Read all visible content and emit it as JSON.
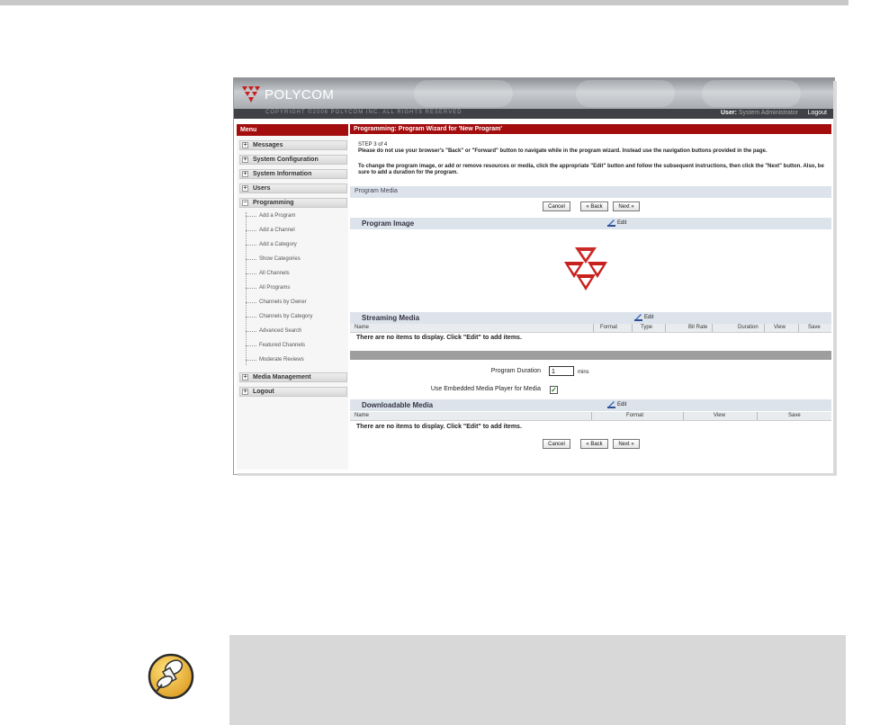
{
  "header": {
    "brand": "POLYCOM",
    "copyright": "COPYRIGHT ©2006 POLYCOM INC. ALL RIGHTS RESERVED",
    "user_label": "User:",
    "user_name": "System Administrator",
    "logout": "Logout"
  },
  "menu": {
    "title": "Menu",
    "cats": {
      "messages": "Messages",
      "system_configuration": "System Configuration",
      "system_information": "System Information",
      "users": "Users",
      "programming": "Programming",
      "media_management": "Media Management",
      "logout": "Logout"
    },
    "programming_items": [
      "Add a Program",
      "Add a Channel",
      "Add a Category",
      "Show Categories",
      "All Channels",
      "All Programs",
      "Channels by Owner",
      "Channels by Category",
      "Advanced Search",
      "Featured Channels",
      "Moderate Reviews"
    ]
  },
  "main": {
    "title": "Programming: Program Wizard for 'New Program'",
    "step": "STEP 3 of 4",
    "warning": "Please do not use your browser's \"Back\" or \"Forward\" button to navigate while in the program wizard. Instead use the navigation buttons provided in the page.",
    "instructions": "To change the program image, or add or remove resources or media, click the appropriate \"Edit\" button and follow the subsequent instructions, then click the \"Next\" button. Also, be sure to add a duration for the program.",
    "section_program_media": "Program Media",
    "buttons": {
      "cancel": "Cancel",
      "back": "« Back",
      "next": "Next »"
    },
    "program_image": {
      "title": "Program Image",
      "edit": "Edit"
    },
    "streaming_media": {
      "title": "Streaming Media",
      "edit": "Edit",
      "columns": [
        "Name",
        "Format",
        "Type",
        "Bit Rate",
        "Duration",
        "View",
        "Save"
      ],
      "empty": "There are no items to display. Click \"Edit\" to add items."
    },
    "duration": {
      "label": "Program Duration",
      "value": "1",
      "unit": "mins"
    },
    "embedded": {
      "label": "Use Embedded Media Player for Media",
      "checked": true
    },
    "downloadable_media": {
      "title": "Downloadable Media",
      "edit": "Edit",
      "columns": [
        "Name",
        "Format",
        "View",
        "Save"
      ],
      "empty": "There are no items to display. Click \"Edit\" to add items."
    }
  },
  "colors": {
    "brand_red": "#a30d0d",
    "header_gray": "#3f4146",
    "note_bg": "#d8d8d8"
  },
  "icons": {
    "note": "pushpin-icon",
    "edit": "pencil-icon",
    "logo": "polycom-logo-icon"
  }
}
